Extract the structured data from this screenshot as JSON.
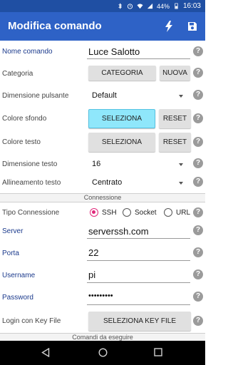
{
  "statusbar": {
    "battery": "44%",
    "time": "16:03"
  },
  "appbar": {
    "title": "Modifica comando",
    "flash_icon": "flash-icon",
    "save_icon": "save-icon"
  },
  "form": {
    "nome_comando": {
      "label": "Nome comando",
      "value": "Luce Salotto"
    },
    "categoria": {
      "label": "Categoria",
      "button": "CATEGORIA",
      "new_button": "NUOVA"
    },
    "dimensione_pulsante": {
      "label": "Dimensione pulsante",
      "value": "Default"
    },
    "colore_sfondo": {
      "label": "Colore sfondo",
      "button": "SELEZIONA",
      "reset": "RESET"
    },
    "colore_testo": {
      "label": "Colore testo",
      "button": "SELEZIONA",
      "reset": "RESET"
    },
    "dimensione_testo": {
      "label": "Dimensione testo",
      "value": "16"
    },
    "allineamento_testo": {
      "label": "Allineamento testo",
      "value": "Centrato"
    }
  },
  "section_connessione": "Connessione",
  "connection": {
    "tipo": {
      "label": "Tipo Connessione",
      "options": [
        "SSH",
        "Socket",
        "URL"
      ],
      "selected": "SSH"
    },
    "server": {
      "label": "Server",
      "value": "serverssh.com"
    },
    "porta": {
      "label": "Porta",
      "value": "22"
    },
    "username": {
      "label": "Username",
      "value": "pi"
    },
    "password": {
      "label": "Password",
      "value": "•••••••••"
    },
    "key_file": {
      "label": "Login con Key File",
      "button": "SELEZIONA KEY FILE"
    }
  },
  "section_comandi": "Comandi da eseguire",
  "help_glyph": "?",
  "accent_colors": {
    "appbar": "#2e62c6",
    "statusbar": "#1f4fa3",
    "radio": "#e0287a",
    "selected_button": "#8fe7fb"
  }
}
